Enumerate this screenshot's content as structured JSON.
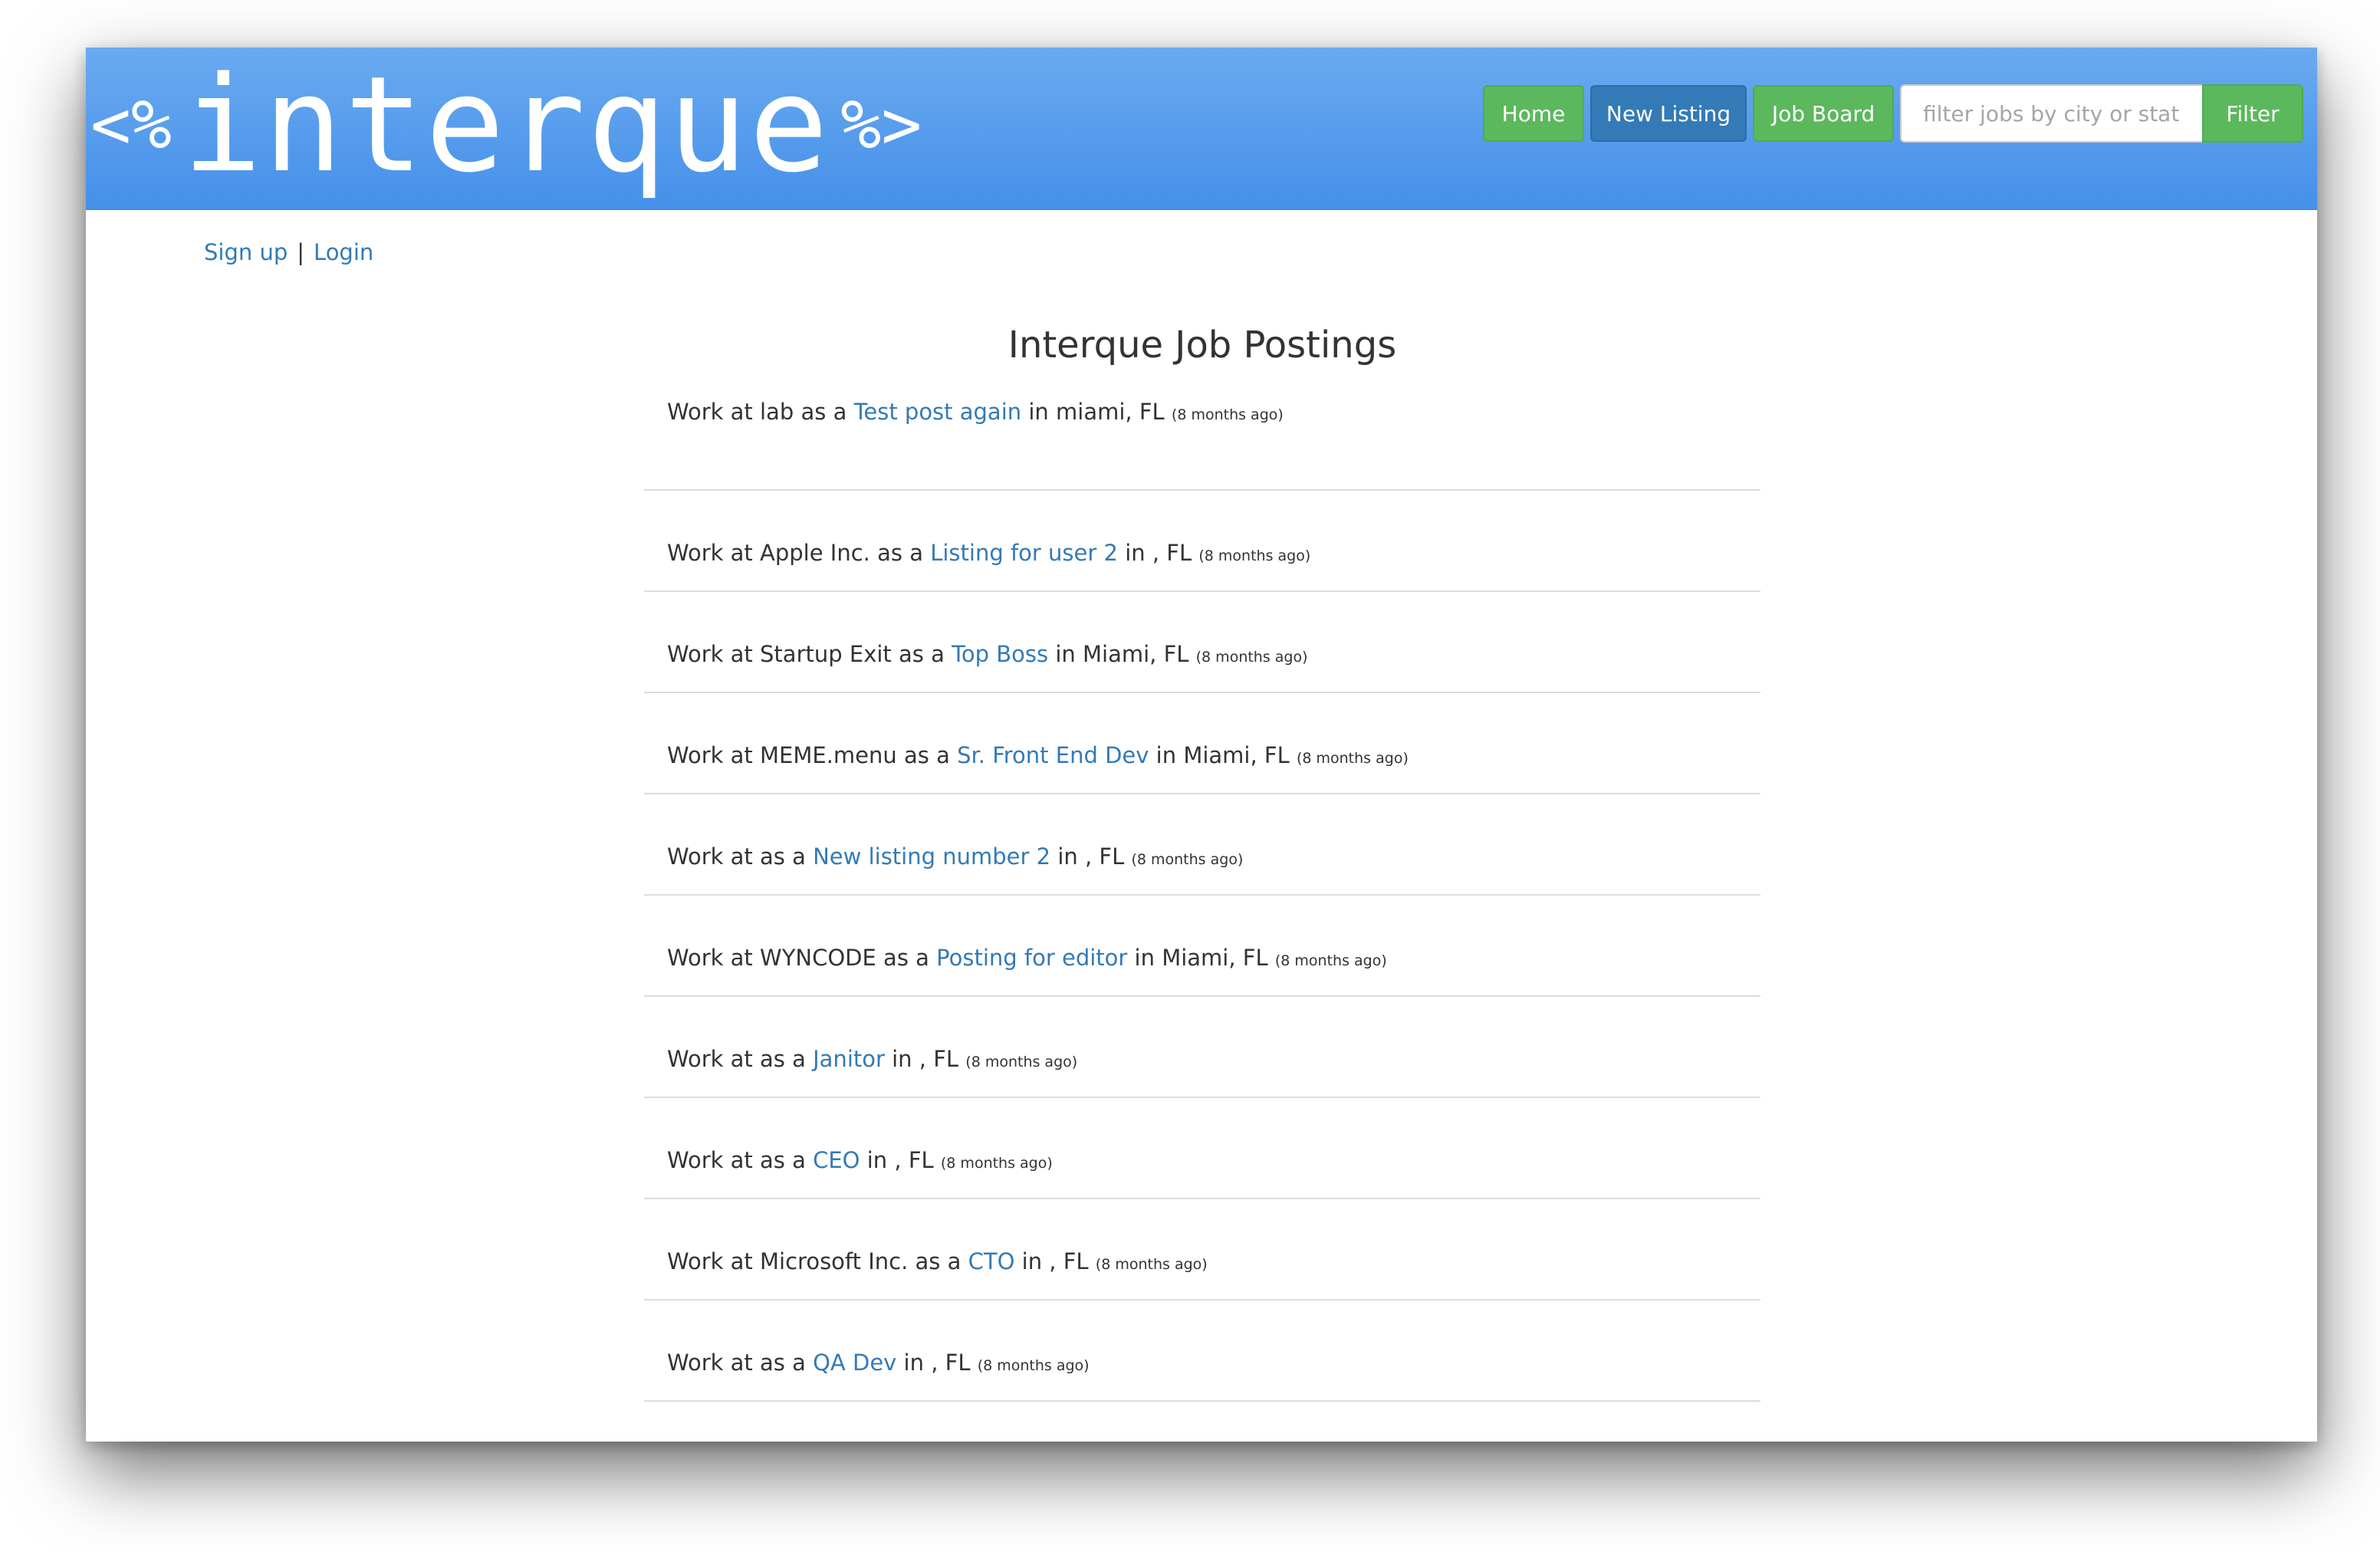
{
  "header": {
    "brand_open": "<%",
    "brand_word": "interque",
    "brand_close": "%>",
    "nav": {
      "home": "Home",
      "new_listing": "New Listing",
      "job_board": "Job Board"
    },
    "filter": {
      "placeholder": "filter jobs by city or state",
      "value": "",
      "button": "Filter"
    },
    "colors": {
      "header_top": "#6aaaf0",
      "header_bottom": "#4590ea",
      "green": "#5cb85c",
      "blue": "#337ab7"
    }
  },
  "auth": {
    "signup": "Sign up",
    "separator": "|",
    "login": "Login"
  },
  "main": {
    "title": "Interque Job Postings",
    "postings": [
      {
        "prefix": "Work at",
        "company": "lab",
        "as": "as a",
        "title": "Test post again",
        "in": "in",
        "city": "miami,",
        "state": "FL",
        "ago": "(8 months ago)"
      },
      {
        "prefix": "Work at",
        "company": "Apple Inc.",
        "as": "as a",
        "title": "Listing for user 2",
        "in": "in",
        "city": ",",
        "state": "FL",
        "ago": "(8 months ago)"
      },
      {
        "prefix": "Work at",
        "company": "Startup Exit",
        "as": "as a",
        "title": "Top Boss",
        "in": "in",
        "city": "Miami,",
        "state": "FL",
        "ago": "(8 months ago)"
      },
      {
        "prefix": "Work at",
        "company": "MEME.menu",
        "as": "as a",
        "title": "Sr. Front End Dev",
        "in": "in",
        "city": "Miami,",
        "state": "FL",
        "ago": "(8 months ago)"
      },
      {
        "prefix": "Work at",
        "company": "",
        "as": "as a",
        "title": "New listing number 2",
        "in": "in",
        "city": ",",
        "state": "FL",
        "ago": "(8 months ago)"
      },
      {
        "prefix": "Work at",
        "company": "WYNCODE",
        "as": "as a",
        "title": "Posting for editor",
        "in": "in",
        "city": "Miami,",
        "state": "FL",
        "ago": "(8 months ago)"
      },
      {
        "prefix": "Work at",
        "company": "",
        "as": "as a",
        "title": "Janitor",
        "in": "in",
        "city": ",",
        "state": "FL",
        "ago": "(8 months ago)"
      },
      {
        "prefix": "Work at",
        "company": "",
        "as": "as a",
        "title": "CEO",
        "in": "in",
        "city": ",",
        "state": "FL",
        "ago": "(8 months ago)"
      },
      {
        "prefix": "Work at",
        "company": "Microsoft Inc.",
        "as": "as a",
        "title": "CTO",
        "in": "in",
        "city": ",",
        "state": "FL",
        "ago": "(8 months ago)"
      },
      {
        "prefix": "Work at",
        "company": "",
        "as": "as a",
        "title": "QA Dev",
        "in": "in",
        "city": ",",
        "state": "FL",
        "ago": "(8 months ago)"
      }
    ]
  }
}
